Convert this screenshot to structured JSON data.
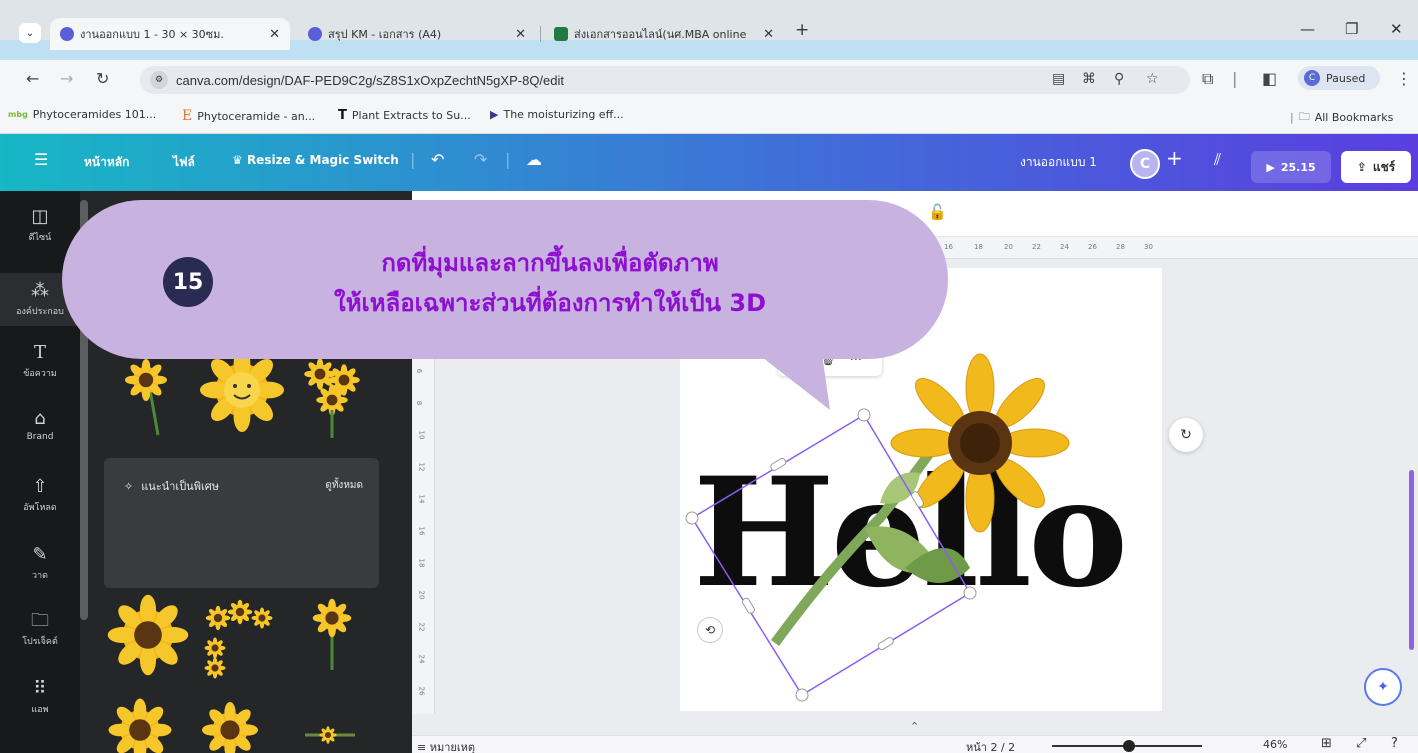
{
  "browser": {
    "tabs": [
      {
        "title": "งานออกแบบ 1 - 30 × 30ซม.",
        "active": true
      },
      {
        "title": "สรุป KM - เอกสาร (A4)",
        "active": false
      },
      {
        "title": "ส่งเอกสารออนไลน์(นศ.MBA online",
        "active": false
      }
    ],
    "newtab": "+",
    "url": "canva.com/design/DAF-PED9C2g/sZ8S1xOxpZechtN5gXP-8Q/edit",
    "profile_status": "Paused",
    "profile_initial": "C",
    "bookmarks": [
      {
        "label": "Phytoceramides 101...",
        "icon": "mbg-logo-icon"
      },
      {
        "label": "Phytoceramide - an...",
        "icon": "f-logo-icon"
      },
      {
        "label": "Plant Extracts to Su...",
        "icon": "t-logo-icon"
      },
      {
        "label": "The moisturizing eff...",
        "icon": "play-logo-icon"
      }
    ],
    "all_bookmarks": "All Bookmarks"
  },
  "canva_bar": {
    "home": "หน้าหลัก",
    "file": "ไฟล์",
    "resize": "Resize & Magic Switch",
    "design_name": "งานออกแบบ 1",
    "avatar_initial": "C",
    "present_time": "25.15",
    "share": "แชร์"
  },
  "rail": [
    {
      "label": "ดีไซน์",
      "icon": "design-icon"
    },
    {
      "label": "องค์ประกอบ",
      "icon": "elements-icon"
    },
    {
      "label": "ข้อความ",
      "icon": "text-icon"
    },
    {
      "label": "Brand",
      "icon": "brand-icon"
    },
    {
      "label": "อัพโหลด",
      "icon": "upload-icon"
    },
    {
      "label": "วาด",
      "icon": "draw-icon"
    },
    {
      "label": "โปรเจ็คต์",
      "icon": "projects-icon"
    },
    {
      "label": "แอพ",
      "icon": "apps-icon"
    }
  ],
  "panel": {
    "suggest_title": "แนะนำเป็นพิเศษ",
    "see_all": "ดูทั้งหมด"
  },
  "editor": {
    "ruler_ticks": [
      "16",
      "18",
      "20",
      "22",
      "24",
      "26",
      "28",
      "30"
    ],
    "vruler_ticks": [
      "6",
      "8",
      "10",
      "12",
      "14",
      "16",
      "18",
      "20",
      "22",
      "24",
      "26"
    ],
    "canvas_text": "Hello",
    "notes": "หมายเหตุ",
    "page_indicator": "หน้า 2 / 2",
    "zoom": "46%",
    "zoom_value": 0.46,
    "colors": {
      "accent": "#8b5cf6",
      "callout_bg": "#c7b2e0",
      "callout_text": "#8e0fcf",
      "badge_bg": "#2a2b52"
    }
  },
  "callout": {
    "step": "15",
    "line1": "กดที่มุมและลากขึ้นลงเพื่อตัดภาพ",
    "line2": "ให้เหลือเฉพาะส่วนที่ต้องการทำให้เป็น 3D"
  }
}
